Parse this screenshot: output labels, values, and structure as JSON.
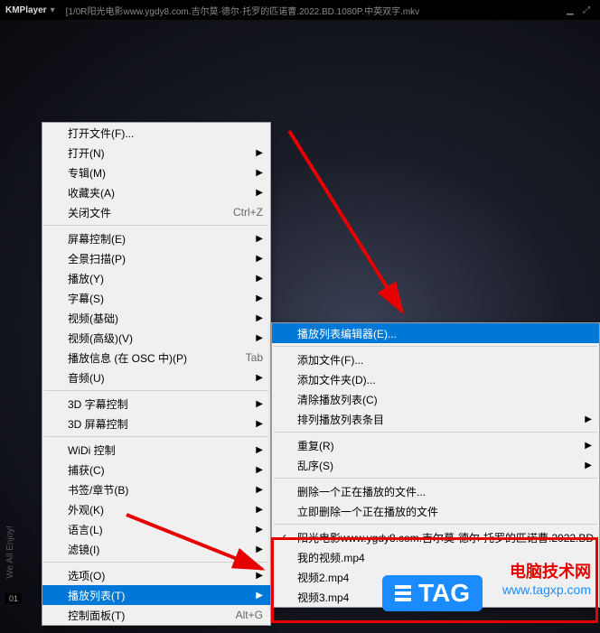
{
  "titlebar": {
    "brand": "KMPlayer",
    "filename": "[1/0R阳光电影www.ygdy8.com.吉尔莫·德尔·托罗的匹诺曹.2022.BD.1080P.中英双字.mkv"
  },
  "side": {
    "text": "We All Enjoy!",
    "badge": "01"
  },
  "menu_main": [
    {
      "label": "打开文件(F)...",
      "type": "item"
    },
    {
      "label": "打开(N)",
      "type": "submenu"
    },
    {
      "label": "专辑(M)",
      "type": "submenu"
    },
    {
      "label": "收藏夹(A)",
      "type": "submenu"
    },
    {
      "label": "关闭文件",
      "shortcut": "Ctrl+Z",
      "type": "item"
    },
    {
      "type": "sep"
    },
    {
      "label": "屏幕控制(E)",
      "type": "submenu"
    },
    {
      "label": "全景扫描(P)",
      "type": "submenu"
    },
    {
      "label": "播放(Y)",
      "type": "submenu"
    },
    {
      "label": "字幕(S)",
      "type": "submenu"
    },
    {
      "label": "视频(基础)",
      "type": "submenu"
    },
    {
      "label": "视频(高级)(V)",
      "type": "submenu"
    },
    {
      "label": "播放信息 (在 OSC 中)(P)",
      "shortcut": "Tab",
      "type": "item"
    },
    {
      "label": "音频(U)",
      "type": "submenu"
    },
    {
      "type": "sep"
    },
    {
      "label": "3D 字幕控制",
      "type": "submenu"
    },
    {
      "label": "3D 屏幕控制",
      "type": "submenu"
    },
    {
      "type": "sep"
    },
    {
      "label": "WiDi 控制",
      "type": "submenu"
    },
    {
      "label": "捕获(C)",
      "type": "submenu"
    },
    {
      "label": "书签/章节(B)",
      "type": "submenu"
    },
    {
      "label": "外观(K)",
      "type": "submenu"
    },
    {
      "label": "语言(L)",
      "type": "submenu"
    },
    {
      "label": "滤镜(I)",
      "type": "submenu"
    },
    {
      "type": "sep"
    },
    {
      "label": "选项(O)",
      "type": "submenu"
    },
    {
      "label": "播放列表(T)",
      "type": "submenu",
      "highlight": true
    },
    {
      "label": "控制面板(T)",
      "shortcut": "Alt+G",
      "type": "item"
    }
  ],
  "menu_sub": [
    {
      "label": "播放列表编辑器(E)...",
      "type": "item",
      "highlight": true
    },
    {
      "type": "sep"
    },
    {
      "label": "添加文件(F)...",
      "type": "item"
    },
    {
      "label": "添加文件夹(D)...",
      "type": "item"
    },
    {
      "label": "清除播放列表(C)",
      "type": "item"
    },
    {
      "label": "排列播放列表条目",
      "type": "submenu"
    },
    {
      "type": "sep"
    },
    {
      "label": "重复(R)",
      "type": "submenu"
    },
    {
      "label": "乱序(S)",
      "type": "submenu"
    },
    {
      "type": "sep"
    },
    {
      "label": "删除一个正在播放的文件...",
      "type": "item"
    },
    {
      "label": "立即删除一个正在播放的文件",
      "type": "item"
    },
    {
      "type": "sep"
    },
    {
      "label": "阳光电影www.ygdy8.com.吉尔莫·德尔·托罗的匹诺曹.2022.BD",
      "type": "item",
      "checked": true
    },
    {
      "label": "我的视频.mp4",
      "type": "item"
    },
    {
      "label": "视频2.mp4",
      "type": "item"
    },
    {
      "label": "视频3.mp4",
      "type": "item"
    }
  ],
  "overlay": {
    "tag": "TAG",
    "site_cn": "电脑技术网",
    "site_url": "www.tagxp.com"
  }
}
